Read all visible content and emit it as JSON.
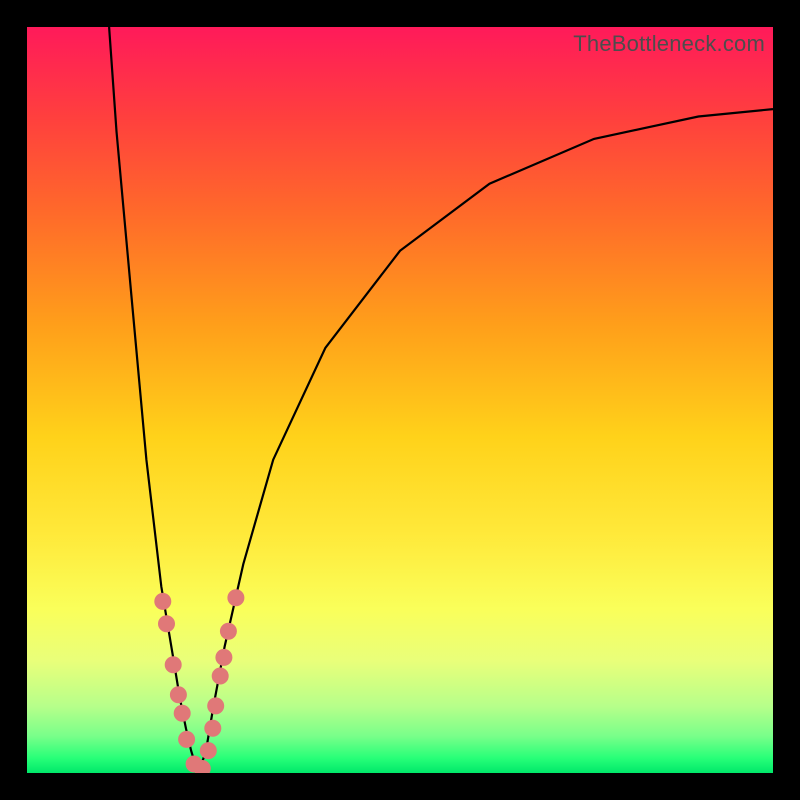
{
  "watermark": "TheBottleneck.com",
  "colors": {
    "frame": "#000000",
    "curve": "#000000",
    "dots": "#e07878",
    "gradient_top": "#ff1a5a",
    "gradient_bottom": "#00e86a"
  },
  "chart_data": {
    "type": "line",
    "title": "",
    "xlabel": "",
    "ylabel": "",
    "xlim": [
      0,
      100
    ],
    "ylim": [
      0,
      100
    ],
    "series": [
      {
        "name": "left-branch",
        "x": [
          11,
          12,
          14,
          16,
          18,
          19.5,
          20.5,
          21.3,
          22,
          22.6,
          23
        ],
        "values": [
          100,
          86,
          64,
          42,
          25,
          16,
          10,
          6,
          3,
          1,
          0
        ]
      },
      {
        "name": "right-branch",
        "x": [
          23,
          24,
          25,
          26.5,
          29,
          33,
          40,
          50,
          62,
          76,
          90,
          100
        ],
        "values": [
          0,
          3,
          9,
          17,
          28,
          42,
          57,
          70,
          79,
          85,
          88,
          89
        ]
      }
    ],
    "dots": [
      {
        "x": 18.2,
        "y": 23
      },
      {
        "x": 18.7,
        "y": 20
      },
      {
        "x": 19.6,
        "y": 14.5
      },
      {
        "x": 20.3,
        "y": 10.5
      },
      {
        "x": 20.8,
        "y": 8
      },
      {
        "x": 21.4,
        "y": 4.5
      },
      {
        "x": 22.4,
        "y": 1.2
      },
      {
        "x": 23.5,
        "y": 0.6
      },
      {
        "x": 24.3,
        "y": 3
      },
      {
        "x": 24.9,
        "y": 6
      },
      {
        "x": 25.3,
        "y": 9
      },
      {
        "x": 25.9,
        "y": 13
      },
      {
        "x": 26.4,
        "y": 15.5
      },
      {
        "x": 27.0,
        "y": 19
      },
      {
        "x": 28.0,
        "y": 23.5
      }
    ],
    "pale_band_y": [
      57,
      65
    ]
  }
}
